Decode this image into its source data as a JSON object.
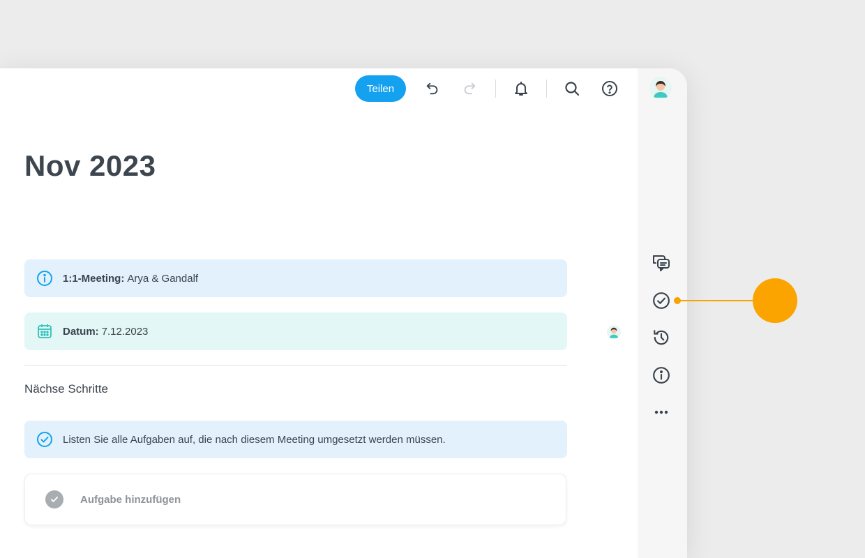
{
  "toolbar": {
    "share_label": "Teilen",
    "icons": [
      "undo-icon",
      "redo-icon",
      "bell-icon",
      "search-icon",
      "help-icon"
    ]
  },
  "page": {
    "title": "Nov 2023"
  },
  "callouts": {
    "meeting": {
      "label": "1:1-Meeting:",
      "value": "Arya & Gandalf"
    },
    "date": {
      "label": "Datum:",
      "value": "7.12.2023"
    }
  },
  "section": {
    "next_steps_title": "Nächse Schritte",
    "hint": "Listen Sie alle Aufgaben auf, die nach diesem Meeting umgesetzt werden müssen.",
    "add_task_label": "Aufgabe hinzufügen"
  },
  "sidebar": {
    "icons": [
      "comments-icon",
      "check-circle-icon",
      "history-icon",
      "info-icon",
      "more-icon"
    ]
  },
  "colors": {
    "accent": "#14a2f0",
    "pointer": "#fba400",
    "callout_blue": "#e2f1fc",
    "callout_mint": "#e3f7f6"
  }
}
